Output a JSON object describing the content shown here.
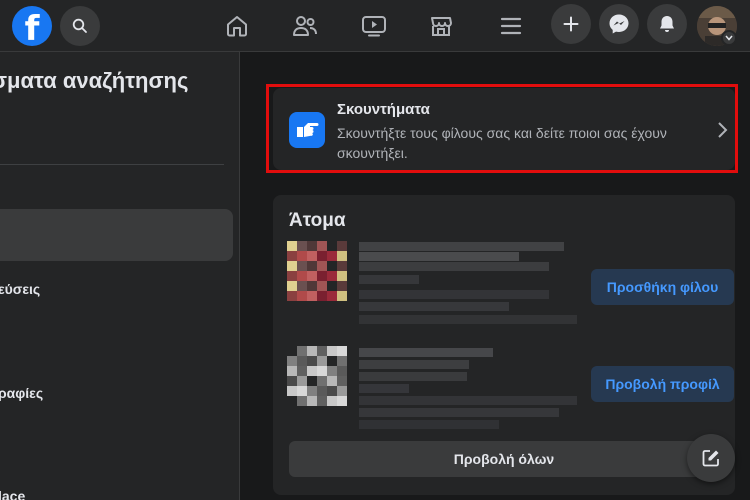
{
  "topbar": {
    "logo_text": "f",
    "icons": [
      "search-icon",
      "home-icon",
      "friends-icon",
      "video-icon",
      "marketplace-icon",
      "menu-icon",
      "plus-icon",
      "messenger-icon",
      "bell-icon",
      "avatar"
    ]
  },
  "sidebar": {
    "title_fragment": "σματα αναζήτησης",
    "item_fragments": [
      "εύσεις",
      "ραφίες",
      "lace"
    ]
  },
  "poke": {
    "title": "Σκουντήματα",
    "description": "Σκουντήξτε τους φίλους σας και δείτε ποιοι σας έχουν σκουντήξει."
  },
  "people": {
    "title": "Άτομα",
    "results": [
      {
        "action_label": "Προσθήκη φίλου"
      },
      {
        "action_label": "Προβολή προφίλ"
      }
    ],
    "view_all_label": "Προβολή όλων"
  },
  "colors": {
    "background": "#18191a",
    "card": "#242526",
    "accent": "#1877f2",
    "highlight": "#e10d0d",
    "action_text": "#4599ff"
  }
}
